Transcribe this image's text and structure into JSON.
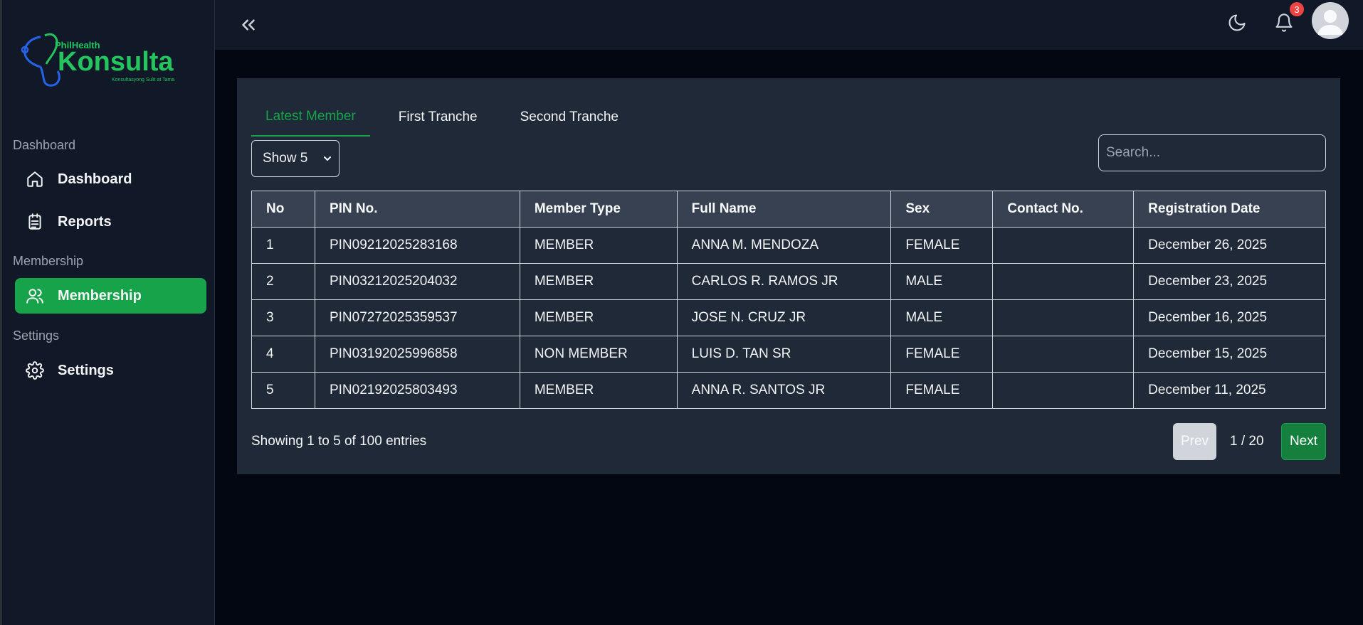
{
  "brand": {
    "top": "PhilHealth",
    "name": "Konsulta",
    "tagline": "Konsultasyong Sulit at Tama"
  },
  "sidebar": {
    "sections": [
      {
        "title": "Dashboard",
        "items": [
          {
            "label": "Dashboard",
            "icon": "home-icon"
          },
          {
            "label": "Reports",
            "icon": "clipboard-icon"
          }
        ]
      },
      {
        "title": "Membership",
        "items": [
          {
            "label": "Membership",
            "icon": "users-icon",
            "active": true
          }
        ]
      },
      {
        "title": "Settings",
        "items": [
          {
            "label": "Settings",
            "icon": "gear-icon"
          }
        ]
      }
    ]
  },
  "topbar": {
    "notification_count": "3"
  },
  "tabs": [
    {
      "label": "Latest Member",
      "active": true
    },
    {
      "label": "First Tranche"
    },
    {
      "label": "Second Tranche"
    }
  ],
  "controls": {
    "page_size_label": "Show 5",
    "search_placeholder": "Search..."
  },
  "table": {
    "columns": [
      "No",
      "PIN No.",
      "Member Type",
      "Full Name",
      "Sex",
      "Contact No.",
      "Registration Date"
    ],
    "rows": [
      [
        "1",
        "PIN09212025283168",
        "MEMBER",
        "ANNA M. MENDOZA",
        "FEMALE",
        "",
        "December 26, 2025"
      ],
      [
        "2",
        "PIN03212025204032",
        "MEMBER",
        "CARLOS R. RAMOS JR",
        "MALE",
        "",
        "December 23, 2025"
      ],
      [
        "3",
        "PIN07272025359537",
        "MEMBER",
        "JOSE N. CRUZ JR",
        "MALE",
        "",
        "December 16, 2025"
      ],
      [
        "4",
        "PIN03192025996858",
        "NON MEMBER",
        "LUIS D. TAN SR",
        "FEMALE",
        "",
        "December 15, 2025"
      ],
      [
        "5",
        "PIN02192025803493",
        "MEMBER",
        "ANNA R. SANTOS JR",
        "FEMALE",
        "",
        "December 11, 2025"
      ]
    ]
  },
  "pagination": {
    "summary": "Showing 1 to 5 of 100 entries",
    "prev_label": "Prev",
    "page_indicator": "1 / 20",
    "next_label": "Next"
  },
  "colors": {
    "accent": "#16a34a",
    "sidebar_bg": "#111827",
    "card_bg": "#1f2937",
    "page_bg": "#030712",
    "badge": "#ef4444"
  }
}
